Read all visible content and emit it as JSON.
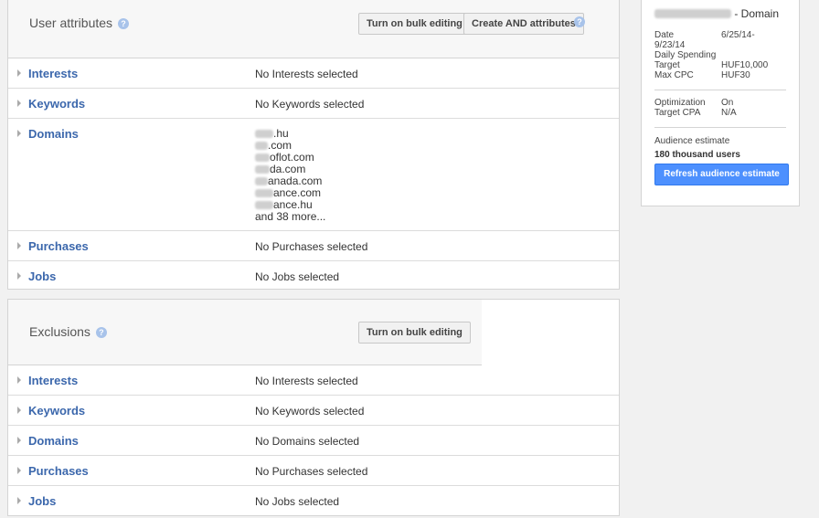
{
  "user_attributes": {
    "title": "User attributes",
    "help": "?",
    "bulk_edit_label": "Turn on bulk editing",
    "create_and_label": "Create AND attributes",
    "rows": [
      {
        "label": "Interests",
        "value": "No Interests selected"
      },
      {
        "label": "Keywords",
        "value": "No Keywords selected"
      },
      {
        "label": "Domains",
        "domains": [
          ".hu",
          ".com",
          "oflot.com",
          "da.com",
          "anada.com",
          "ance.com",
          "ance.hu"
        ],
        "more": "and 38 more..."
      },
      {
        "label": "Purchases",
        "value": "No Purchases selected"
      },
      {
        "label": "Jobs",
        "value": "No Jobs selected"
      }
    ]
  },
  "exclusions": {
    "title": "Exclusions",
    "help": "?",
    "bulk_edit_label": "Turn on bulk editing",
    "rows": [
      {
        "label": "Interests",
        "value": "No Interests selected"
      },
      {
        "label": "Keywords",
        "value": "No Keywords selected"
      },
      {
        "label": "Domains",
        "value": "No Domains selected"
      },
      {
        "label": "Purchases",
        "value": "No Purchases selected"
      },
      {
        "label": "Jobs",
        "value": "No Jobs selected"
      }
    ]
  },
  "summary": {
    "title_suffix": "- Domain",
    "date_label": "Date",
    "date_value_1": "6/25/14-",
    "date_value_2": "9/23/14",
    "daily_label_1": "Daily Spending",
    "daily_label_2": "Target",
    "daily_value": "HUF10,000",
    "maxcpc_label": "Max CPC",
    "maxcpc_value": "HUF30",
    "optimization_label": "Optimization",
    "optimization_value": "On",
    "target_cpa_label": "Target CPA",
    "target_cpa_value": "N/A",
    "audience_label": "Audience estimate",
    "audience_value": "180 thousand users",
    "refresh_label": "Refresh audience estimate"
  },
  "colors": {
    "link": "#3b67ac",
    "primary_button": "#4d90fe"
  }
}
